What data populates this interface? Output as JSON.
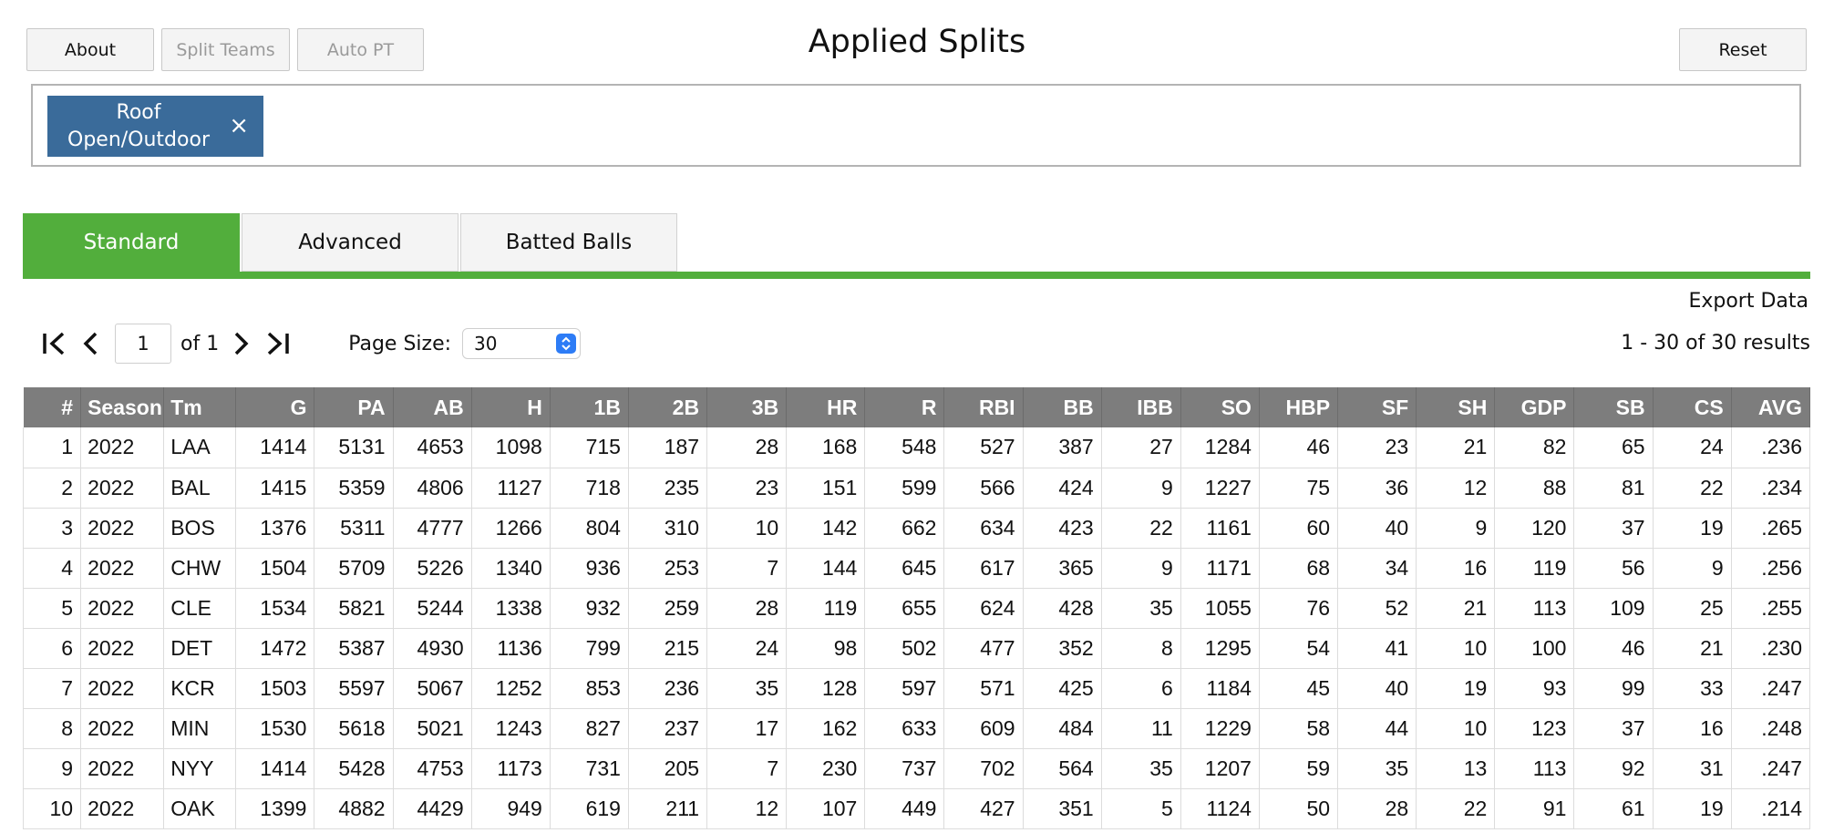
{
  "toolbar": {
    "about_label": "About",
    "split_teams_label": "Split Teams",
    "auto_pt_label": "Auto PT",
    "reset_label": "Reset"
  },
  "page_title": "Applied Splits",
  "applied_splits": [
    {
      "label": "Roof Open/Outdoor"
    }
  ],
  "tabs": [
    {
      "label": "Standard",
      "active": true
    },
    {
      "label": "Advanced",
      "active": false
    },
    {
      "label": "Batted Balls",
      "active": false
    }
  ],
  "export_label": "Export Data",
  "pager": {
    "current_page": "1",
    "of_label": "of 1",
    "page_size_label": "Page Size:",
    "page_size_value": "30",
    "results_label": "1 - 30 of 30 results"
  },
  "table": {
    "columns": [
      "#",
      "Season",
      "Tm",
      "G",
      "PA",
      "AB",
      "H",
      "1B",
      "2B",
      "3B",
      "HR",
      "R",
      "RBI",
      "BB",
      "IBB",
      "SO",
      "HBP",
      "SF",
      "SH",
      "GDP",
      "SB",
      "CS",
      "AVG"
    ],
    "rows": [
      [
        "1",
        "2022",
        "LAA",
        "1414",
        "5131",
        "4653",
        "1098",
        "715",
        "187",
        "28",
        "168",
        "548",
        "527",
        "387",
        "27",
        "1284",
        "46",
        "23",
        "21",
        "82",
        "65",
        "24",
        ".236"
      ],
      [
        "2",
        "2022",
        "BAL",
        "1415",
        "5359",
        "4806",
        "1127",
        "718",
        "235",
        "23",
        "151",
        "599",
        "566",
        "424",
        "9",
        "1227",
        "75",
        "36",
        "12",
        "88",
        "81",
        "22",
        ".234"
      ],
      [
        "3",
        "2022",
        "BOS",
        "1376",
        "5311",
        "4777",
        "1266",
        "804",
        "310",
        "10",
        "142",
        "662",
        "634",
        "423",
        "22",
        "1161",
        "60",
        "40",
        "9",
        "120",
        "37",
        "19",
        ".265"
      ],
      [
        "4",
        "2022",
        "CHW",
        "1504",
        "5709",
        "5226",
        "1340",
        "936",
        "253",
        "7",
        "144",
        "645",
        "617",
        "365",
        "9",
        "1171",
        "68",
        "34",
        "16",
        "119",
        "56",
        "9",
        ".256"
      ],
      [
        "5",
        "2022",
        "CLE",
        "1534",
        "5821",
        "5244",
        "1338",
        "932",
        "259",
        "28",
        "119",
        "655",
        "624",
        "428",
        "35",
        "1055",
        "76",
        "52",
        "21",
        "113",
        "109",
        "25",
        ".255"
      ],
      [
        "6",
        "2022",
        "DET",
        "1472",
        "5387",
        "4930",
        "1136",
        "799",
        "215",
        "24",
        "98",
        "502",
        "477",
        "352",
        "8",
        "1295",
        "54",
        "41",
        "10",
        "100",
        "46",
        "21",
        ".230"
      ],
      [
        "7",
        "2022",
        "KCR",
        "1503",
        "5597",
        "5067",
        "1252",
        "853",
        "236",
        "35",
        "128",
        "597",
        "571",
        "425",
        "6",
        "1184",
        "45",
        "40",
        "19",
        "93",
        "99",
        "33",
        ".247"
      ],
      [
        "8",
        "2022",
        "MIN",
        "1530",
        "5618",
        "5021",
        "1243",
        "827",
        "237",
        "17",
        "162",
        "633",
        "609",
        "484",
        "11",
        "1229",
        "58",
        "44",
        "10",
        "123",
        "37",
        "16",
        ".248"
      ],
      [
        "9",
        "2022",
        "NYY",
        "1414",
        "5428",
        "4753",
        "1173",
        "731",
        "205",
        "7",
        "230",
        "737",
        "702",
        "564",
        "35",
        "1207",
        "59",
        "35",
        "13",
        "113",
        "92",
        "31",
        ".247"
      ],
      [
        "10",
        "2022",
        "OAK",
        "1399",
        "4882",
        "4429",
        "949",
        "619",
        "211",
        "12",
        "107",
        "449",
        "427",
        "351",
        "5",
        "1124",
        "50",
        "28",
        "22",
        "91",
        "61",
        "19",
        ".214"
      ]
    ]
  },
  "colors": {
    "accent_green": "#52ae3c",
    "tag_blue": "#3a6b9a",
    "header_gray": "#7d7d7d",
    "select_blue": "#2d7cf6"
  },
  "icons": [
    "first-page-icon",
    "prev-page-icon",
    "next-page-icon",
    "last-page-icon",
    "close-icon",
    "select-arrows-icon"
  ]
}
